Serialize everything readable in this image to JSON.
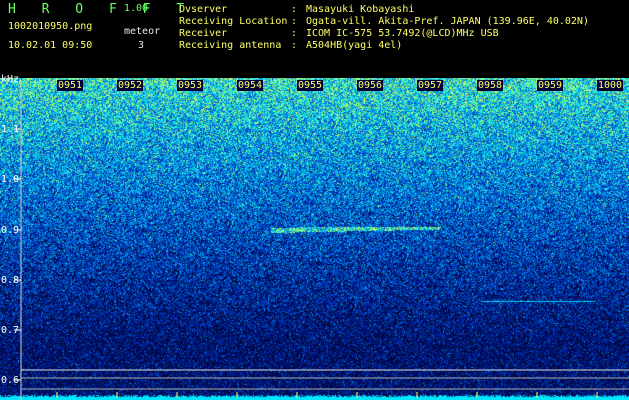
{
  "app": {
    "title": "H R O F F T",
    "version": "1.00"
  },
  "file": {
    "name": "1002010950.png",
    "datetime": "10.02.01 09:50"
  },
  "meteor": {
    "label": "meteor",
    "count": "3"
  },
  "info": [
    {
      "label": "Ovserver",
      "sep": ":",
      "value": "Masayuki Kobayashi"
    },
    {
      "label": "Receiving Location",
      "sep": ":",
      "value": "Ogata-vill. Akita-Pref. JAPAN (139.96E, 40.02N)"
    },
    {
      "label": "Receiver",
      "sep": ":",
      "value": "ICOM IC-575 53.7492(@LCD)MHz USB"
    },
    {
      "label": "Receiving antenna",
      "sep": ":",
      "value": "A504HB(yagi 4el)"
    }
  ],
  "axis": {
    "unit": "kHz",
    "y_ticks": [
      "1.1",
      "1.0",
      "0.9",
      "0.8",
      "0.7",
      "0.6"
    ],
    "time_ticks": [
      "0951",
      "0952",
      "0953",
      "0954",
      "0955",
      "0956",
      "0957",
      "0958",
      "0959",
      "1000"
    ]
  },
  "colors": {
    "background": "#000000",
    "header_yellow": "#ffff66",
    "title_green": "#66ff66",
    "spectrum_low": "#000a55",
    "spectrum_high": "#00ffff"
  }
}
